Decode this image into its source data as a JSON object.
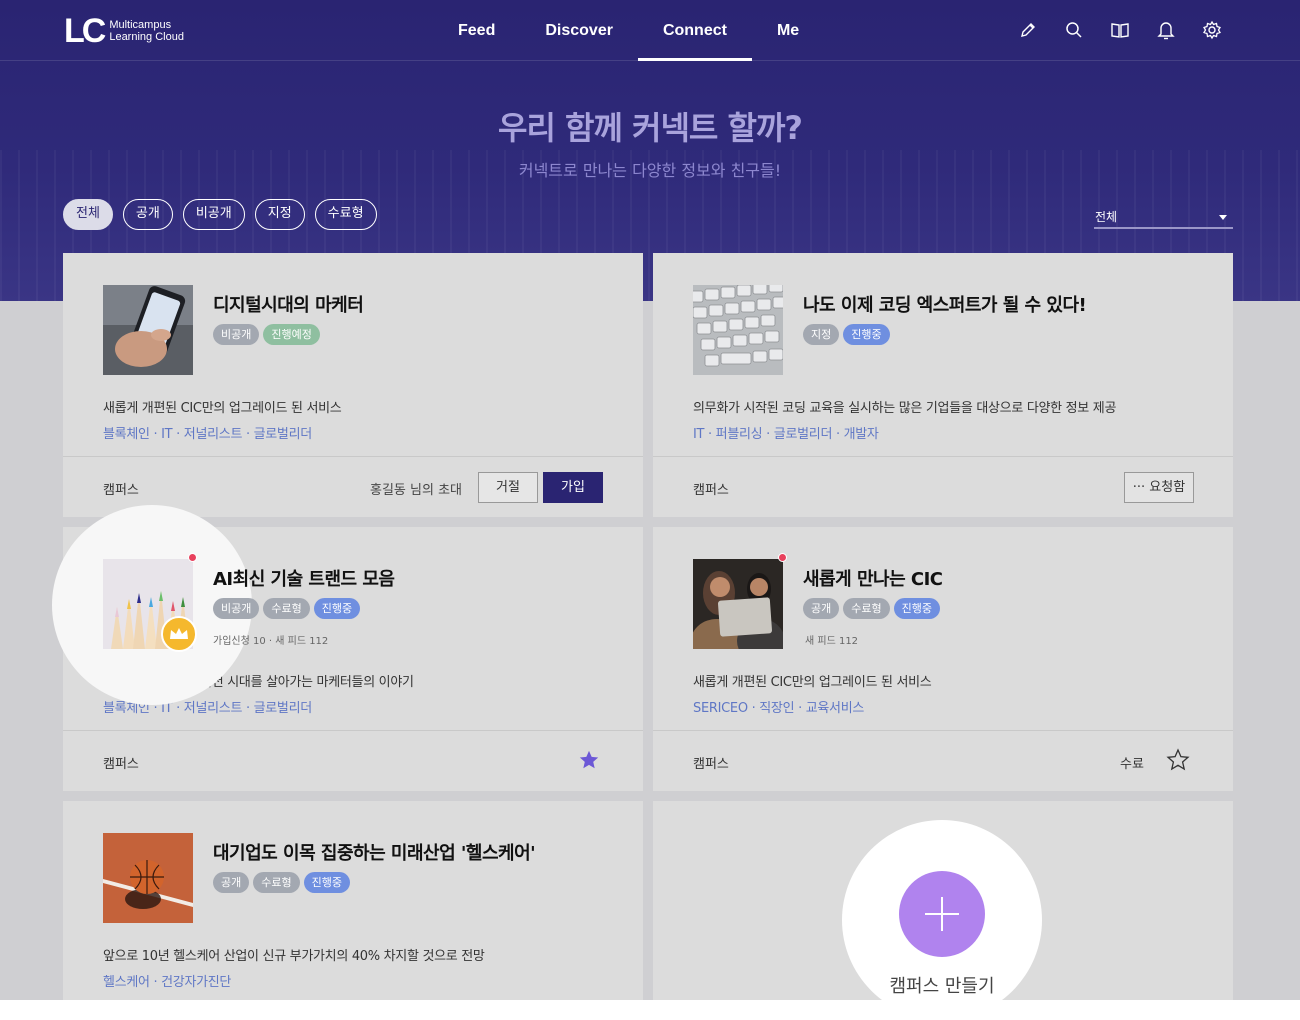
{
  "brand": {
    "mark": "LC",
    "name_line1": "Multicampus",
    "name_line2": "Learning Cloud"
  },
  "nav": {
    "tabs": [
      {
        "label": "Feed"
      },
      {
        "label": "Discover"
      },
      {
        "label": "Connect",
        "active": true
      },
      {
        "label": "Me"
      }
    ],
    "icons": [
      "pencil-icon",
      "search-icon",
      "book-icon",
      "bell-icon",
      "gear-icon"
    ]
  },
  "hero": {
    "title": "우리 함께 커넥트 할까?",
    "subtitle": "커넥트로 만나는 다양한 정보와 친구들!"
  },
  "filters": {
    "chips": [
      "전체",
      "공개",
      "비공개",
      "지정",
      "수료형"
    ],
    "active": "전체",
    "sort_value": "전체"
  },
  "cards": [
    {
      "title": "디지털시대의 마케터",
      "tags": [
        {
          "label": "비공개",
          "color": "gray"
        },
        {
          "label": "진행예정",
          "color": "green"
        }
      ],
      "description": "새롭게 개편된 CIC만의 업그레이드 된 서비스",
      "hashtags": "블록체인 · IT · 저널리스트 · 글로벌리더",
      "footer_label": "캠퍼스",
      "invite_text": "홍길동 님의 초대",
      "reject_label": "거절",
      "join_label": "가입"
    },
    {
      "title": "나도 이제 코딩 엑스퍼트가 될 수 있다!",
      "tags": [
        {
          "label": "지정",
          "color": "gray"
        },
        {
          "label": "진행중",
          "color": "blue"
        }
      ],
      "description": "의무화가 시작된 코딩 교육을 실시하는 많은 기업들을 대상으로 다양한 정보 제공",
      "hashtags": "IT · 퍼블리싱 · 글로벌리더 · 개발자",
      "footer_label": "캠퍼스",
      "request_label": "··· 요청함"
    },
    {
      "title": "AI최신 기술 트랜드 모음",
      "tags": [
        {
          "label": "비공개",
          "color": "gray"
        },
        {
          "label": "수료형",
          "color": "gray"
        },
        {
          "label": "진행중",
          "color": "blue"
        }
      ],
      "meta": "가입신청 10  ·  새 피드 112",
      "description": "디지털 트랜스포메이션 시대를 살아가는 마케터들의 이야기",
      "hashtags": "블록체인 · IT · 저널리스트 · 글로벌리더",
      "footer_label": "캠퍼스",
      "starred": true
    },
    {
      "title": "새롭게 만나는 CIC",
      "tags": [
        {
          "label": "공개",
          "color": "gray"
        },
        {
          "label": "수료형",
          "color": "gray"
        },
        {
          "label": "진행중",
          "color": "blue"
        }
      ],
      "meta": "새 피드 112",
      "description": "새롭게 개편된 CIC만의 업그레이드 된 서비스",
      "hashtags": "SERICEO · 직장인 · 교육서비스",
      "footer_label": "캠퍼스",
      "status_label": "수료",
      "starred": false
    },
    {
      "title": "대기업도 이목 집중하는 미래산업 '헬스케어'",
      "tags": [
        {
          "label": "공개",
          "color": "gray"
        },
        {
          "label": "수료형",
          "color": "gray"
        },
        {
          "label": "진행중",
          "color": "blue"
        }
      ],
      "description": "앞으로 10년 헬스케어 산업이 신규 부가가치의 40% 차지할 것으로 전망",
      "hashtags": "헬스케어 · 건강자가진단"
    }
  ],
  "create": {
    "label": "캠퍼스 만들기"
  },
  "colors": {
    "primary": "#2a2472",
    "accent_purple": "#b083ee",
    "star": "#6c58d6",
    "tag_blue": "#6f8fe0",
    "tag_green": "#8fbfa0",
    "tag_gray": "#a3a8b1",
    "notification_dot": "#e8415d",
    "crown": "#f5b82d"
  }
}
